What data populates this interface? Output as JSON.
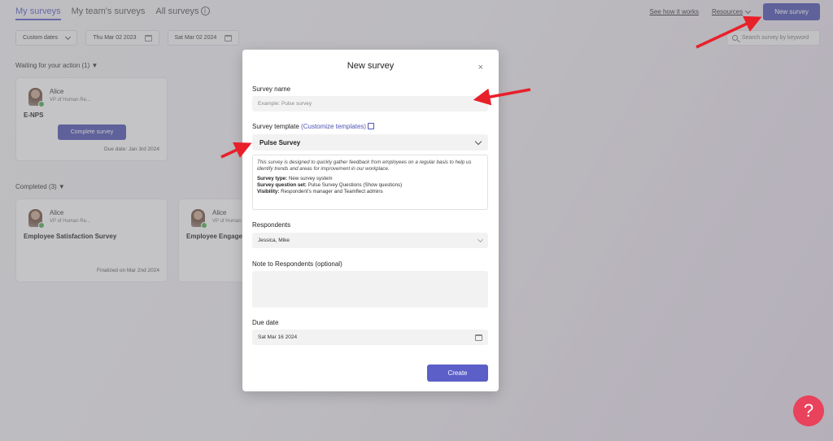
{
  "nav": {
    "tabs": [
      "My surveys",
      "My team's surveys",
      "All surveys"
    ],
    "see_how": "See how it works",
    "resources": "Resources",
    "new_survey": "New survey",
    "search_placeholder": "Search survey by keyword"
  },
  "filters": {
    "range": "Custom dates",
    "start": "Thu Mar 02 2023",
    "end": "Sat Mar 02 2024"
  },
  "waiting": {
    "header": "Waiting for your action (1)",
    "card": {
      "name": "Alice",
      "role": "VP of Human Re...",
      "survey": "E-NPS",
      "button": "Complete survey",
      "due": "Due date: Jan 3rd 2024"
    }
  },
  "completed": {
    "header": "Completed (3)",
    "cards": [
      {
        "name": "Alice",
        "role": "VP of Human Re...",
        "survey": "Employee Satisfaction Survey",
        "finalized": "Finalized on Mar 2nd 2024"
      },
      {
        "name": "Alice",
        "role": "VP of Human Re...",
        "survey": "Employee Engage"
      }
    ]
  },
  "modal": {
    "title": "New survey",
    "close": "×",
    "survey_name_label": "Survey name",
    "survey_name_placeholder": "Example: Pulse survey",
    "template_label": "Survey template",
    "customize_link": "(Customize templates)",
    "template_value": "Pulse Survey",
    "description": "This survey is designed to quickly gather feedback from employees on a regular basis to help us identify trends and areas for improvement in our workplace.",
    "survey_type_label": "Survey type:",
    "survey_type_value": "New survey system",
    "question_set_label": "Survey question set:",
    "question_set_value": "Pulse Survey Questions (Show questions)",
    "visibility_label": "Visibility:",
    "visibility_value": "Respondent's manager and Teamflect admins",
    "respondents_label": "Respondents",
    "respondents_value": "Jessica, Mike",
    "note_label": "Note to Respondents (optional)",
    "due_label": "Due date",
    "due_value": "Sat Mar 16 2024",
    "create": "Create"
  },
  "help": "?",
  "colors": {
    "accent": "#5b5fc7",
    "help": "#e8425c",
    "annotation": "#e8202a"
  }
}
